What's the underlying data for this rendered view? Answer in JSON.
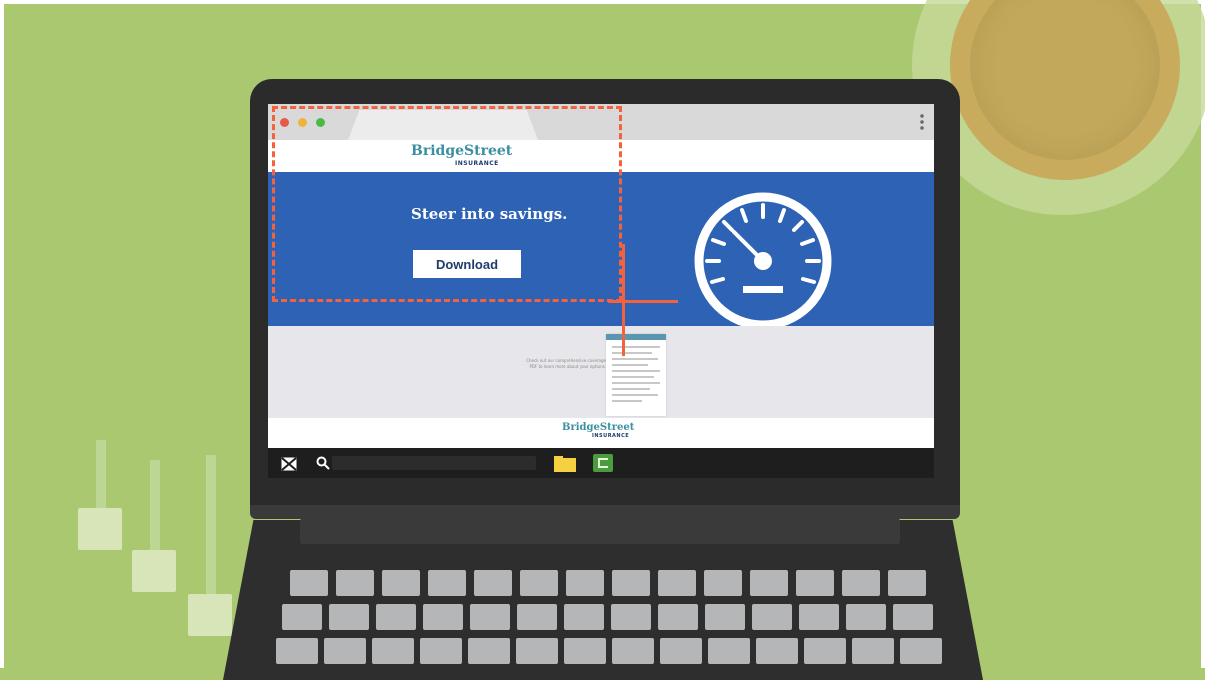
{
  "website": {
    "brand_main": "BridgeStreet",
    "brand_sub": "INSURANCE",
    "hero_heading": "Steer into savings.",
    "hero_button_label": "Download",
    "promo_text": "Check out our comprehensive coverage PDF to learn more about your options.",
    "footer_brand_main": "BridgeStreet",
    "footer_brand_sub": "INSURANCE"
  },
  "colors": {
    "background": "#a9c86f",
    "hero_blue": "#2e62b5",
    "highlight_orange": "#f2623f",
    "brand_teal": "#3a8fa0"
  },
  "taskbar": {
    "icons": [
      "mail-icon",
      "search-icon",
      "folder-icon",
      "app-icon"
    ],
    "search_placeholder": ""
  }
}
